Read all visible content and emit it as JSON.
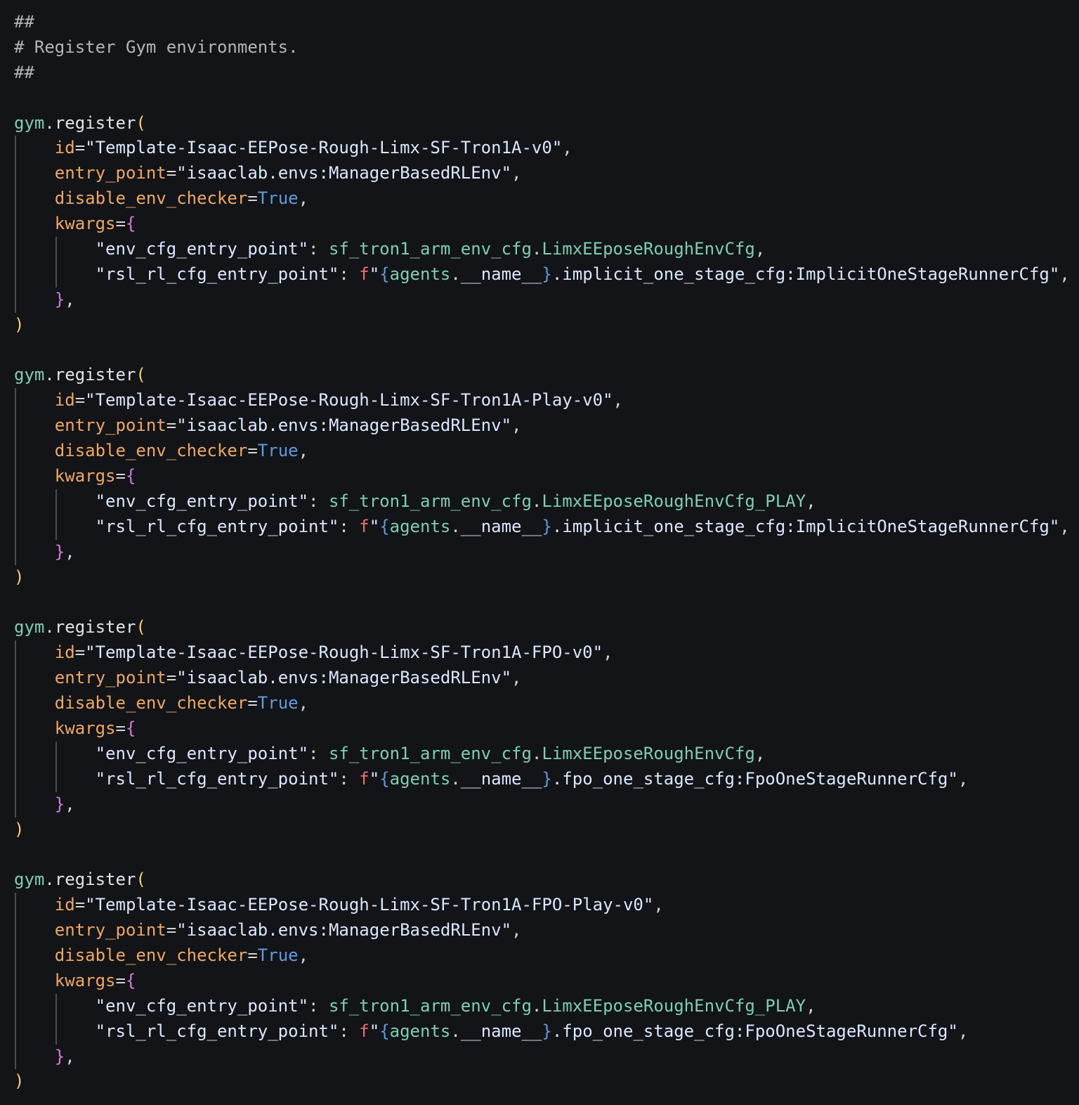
{
  "editor": {
    "theme": {
      "background": "#121418",
      "comment": "#b5b5b5",
      "module": "#7dcfb0",
      "function": "#e2e4e8",
      "paren": "#f4d35e",
      "keyword_arg": "#f0a860",
      "string": "#dbe7fb",
      "boolean": "#5e9be0",
      "brace": "#d57bd6",
      "fstring_prefix": "#ec6f6f"
    },
    "lines": [
      {
        "guides": [],
        "tokens": [
          {
            "t": "##",
            "c": "comment"
          }
        ]
      },
      {
        "guides": [],
        "tokens": [
          {
            "t": "# Register Gym environments.",
            "c": "comment"
          }
        ]
      },
      {
        "guides": [],
        "tokens": [
          {
            "t": "##",
            "c": "comment"
          }
        ]
      },
      {
        "guides": [],
        "tokens": []
      },
      {
        "guides": [],
        "tokens": [
          {
            "t": "gym",
            "c": "module"
          },
          {
            "t": ".",
            "c": "punct"
          },
          {
            "t": "register",
            "c": "fn"
          },
          {
            "t": "(",
            "c": "paren"
          }
        ]
      },
      {
        "guides": [
          0
        ],
        "tokens": [
          {
            "t": "    ",
            "c": "punct"
          },
          {
            "t": "id",
            "c": "kw"
          },
          {
            "t": "=",
            "c": "punct"
          },
          {
            "t": "\"Template-Isaac-EEPose-Rough-Limx-SF-Tron1A-v0\"",
            "c": "str"
          },
          {
            "t": ",",
            "c": "punct"
          }
        ]
      },
      {
        "guides": [
          0
        ],
        "tokens": [
          {
            "t": "    ",
            "c": "punct"
          },
          {
            "t": "entry_point",
            "c": "kw"
          },
          {
            "t": "=",
            "c": "punct"
          },
          {
            "t": "\"isaaclab.envs:ManagerBasedRLEnv\"",
            "c": "str"
          },
          {
            "t": ",",
            "c": "punct"
          }
        ]
      },
      {
        "guides": [
          0
        ],
        "tokens": [
          {
            "t": "    ",
            "c": "punct"
          },
          {
            "t": "disable_env_checker",
            "c": "kw"
          },
          {
            "t": "=",
            "c": "punct"
          },
          {
            "t": "True",
            "c": "bool"
          },
          {
            "t": ",",
            "c": "punct"
          }
        ]
      },
      {
        "guides": [
          0
        ],
        "tokens": [
          {
            "t": "    ",
            "c": "punct"
          },
          {
            "t": "kwargs",
            "c": "kw"
          },
          {
            "t": "=",
            "c": "punct"
          },
          {
            "t": "{",
            "c": "brace"
          }
        ]
      },
      {
        "guides": [
          0,
          1
        ],
        "tokens": [
          {
            "t": "        ",
            "c": "punct"
          },
          {
            "t": "\"env_cfg_entry_point\"",
            "c": "str"
          },
          {
            "t": ": ",
            "c": "punct"
          },
          {
            "t": "sf_tron1_arm_env_cfg",
            "c": "module"
          },
          {
            "t": ".",
            "c": "punct"
          },
          {
            "t": "LimxEEposeRoughEnvCfg",
            "c": "module"
          },
          {
            "t": ",",
            "c": "punct"
          }
        ]
      },
      {
        "guides": [
          0,
          1
        ],
        "tokens": [
          {
            "t": "        ",
            "c": "punct"
          },
          {
            "t": "\"rsl_rl_cfg_entry_point\"",
            "c": "str"
          },
          {
            "t": ": ",
            "c": "punct"
          },
          {
            "t": "f",
            "c": "fprefix"
          },
          {
            "t": "\"",
            "c": "str"
          },
          {
            "t": "{",
            "c": "ibrace"
          },
          {
            "t": "agents",
            "c": "ivar"
          },
          {
            "t": ".",
            "c": "punct"
          },
          {
            "t": "__name__",
            "c": "str"
          },
          {
            "t": "}",
            "c": "ibrace"
          },
          {
            "t": ".implicit_one_stage_cfg:ImplicitOneStageRunnerCfg\"",
            "c": "str"
          },
          {
            "t": ",",
            "c": "punct"
          }
        ]
      },
      {
        "guides": [
          0
        ],
        "tokens": [
          {
            "t": "    ",
            "c": "punct"
          },
          {
            "t": "}",
            "c": "brace"
          },
          {
            "t": ",",
            "c": "punct"
          }
        ]
      },
      {
        "guides": [],
        "tokens": [
          {
            "t": ")",
            "c": "paren"
          }
        ]
      },
      {
        "guides": [],
        "tokens": []
      },
      {
        "guides": [],
        "tokens": [
          {
            "t": "gym",
            "c": "module"
          },
          {
            "t": ".",
            "c": "punct"
          },
          {
            "t": "register",
            "c": "fn"
          },
          {
            "t": "(",
            "c": "paren"
          }
        ]
      },
      {
        "guides": [
          0
        ],
        "tokens": [
          {
            "t": "    ",
            "c": "punct"
          },
          {
            "t": "id",
            "c": "kw"
          },
          {
            "t": "=",
            "c": "punct"
          },
          {
            "t": "\"Template-Isaac-EEPose-Rough-Limx-SF-Tron1A-Play-v0\"",
            "c": "str"
          },
          {
            "t": ",",
            "c": "punct"
          }
        ]
      },
      {
        "guides": [
          0
        ],
        "tokens": [
          {
            "t": "    ",
            "c": "punct"
          },
          {
            "t": "entry_point",
            "c": "kw"
          },
          {
            "t": "=",
            "c": "punct"
          },
          {
            "t": "\"isaaclab.envs:ManagerBasedRLEnv\"",
            "c": "str"
          },
          {
            "t": ",",
            "c": "punct"
          }
        ]
      },
      {
        "guides": [
          0
        ],
        "tokens": [
          {
            "t": "    ",
            "c": "punct"
          },
          {
            "t": "disable_env_checker",
            "c": "kw"
          },
          {
            "t": "=",
            "c": "punct"
          },
          {
            "t": "True",
            "c": "bool"
          },
          {
            "t": ",",
            "c": "punct"
          }
        ]
      },
      {
        "guides": [
          0
        ],
        "tokens": [
          {
            "t": "    ",
            "c": "punct"
          },
          {
            "t": "kwargs",
            "c": "kw"
          },
          {
            "t": "=",
            "c": "punct"
          },
          {
            "t": "{",
            "c": "brace"
          }
        ]
      },
      {
        "guides": [
          0,
          1
        ],
        "tokens": [
          {
            "t": "        ",
            "c": "punct"
          },
          {
            "t": "\"env_cfg_entry_point\"",
            "c": "str"
          },
          {
            "t": ": ",
            "c": "punct"
          },
          {
            "t": "sf_tron1_arm_env_cfg",
            "c": "module"
          },
          {
            "t": ".",
            "c": "punct"
          },
          {
            "t": "LimxEEposeRoughEnvCfg_PLAY",
            "c": "module"
          },
          {
            "t": ",",
            "c": "punct"
          }
        ]
      },
      {
        "guides": [
          0,
          1
        ],
        "tokens": [
          {
            "t": "        ",
            "c": "punct"
          },
          {
            "t": "\"rsl_rl_cfg_entry_point\"",
            "c": "str"
          },
          {
            "t": ": ",
            "c": "punct"
          },
          {
            "t": "f",
            "c": "fprefix"
          },
          {
            "t": "\"",
            "c": "str"
          },
          {
            "t": "{",
            "c": "ibrace"
          },
          {
            "t": "agents",
            "c": "ivar"
          },
          {
            "t": ".",
            "c": "punct"
          },
          {
            "t": "__name__",
            "c": "str"
          },
          {
            "t": "}",
            "c": "ibrace"
          },
          {
            "t": ".implicit_one_stage_cfg:ImplicitOneStageRunnerCfg\"",
            "c": "str"
          },
          {
            "t": ",",
            "c": "punct"
          }
        ]
      },
      {
        "guides": [
          0
        ],
        "tokens": [
          {
            "t": "    ",
            "c": "punct"
          },
          {
            "t": "}",
            "c": "brace"
          },
          {
            "t": ",",
            "c": "punct"
          }
        ]
      },
      {
        "guides": [],
        "tokens": [
          {
            "t": ")",
            "c": "paren"
          }
        ]
      },
      {
        "guides": [],
        "tokens": []
      },
      {
        "guides": [],
        "tokens": [
          {
            "t": "gym",
            "c": "module"
          },
          {
            "t": ".",
            "c": "punct"
          },
          {
            "t": "register",
            "c": "fn"
          },
          {
            "t": "(",
            "c": "paren"
          }
        ]
      },
      {
        "guides": [
          0
        ],
        "tokens": [
          {
            "t": "    ",
            "c": "punct"
          },
          {
            "t": "id",
            "c": "kw"
          },
          {
            "t": "=",
            "c": "punct"
          },
          {
            "t": "\"Template-Isaac-EEPose-Rough-Limx-SF-Tron1A-FPO-v0\"",
            "c": "str"
          },
          {
            "t": ",",
            "c": "punct"
          }
        ]
      },
      {
        "guides": [
          0
        ],
        "tokens": [
          {
            "t": "    ",
            "c": "punct"
          },
          {
            "t": "entry_point",
            "c": "kw"
          },
          {
            "t": "=",
            "c": "punct"
          },
          {
            "t": "\"isaaclab.envs:ManagerBasedRLEnv\"",
            "c": "str"
          },
          {
            "t": ",",
            "c": "punct"
          }
        ]
      },
      {
        "guides": [
          0
        ],
        "tokens": [
          {
            "t": "    ",
            "c": "punct"
          },
          {
            "t": "disable_env_checker",
            "c": "kw"
          },
          {
            "t": "=",
            "c": "punct"
          },
          {
            "t": "True",
            "c": "bool"
          },
          {
            "t": ",",
            "c": "punct"
          }
        ]
      },
      {
        "guides": [
          0
        ],
        "tokens": [
          {
            "t": "    ",
            "c": "punct"
          },
          {
            "t": "kwargs",
            "c": "kw"
          },
          {
            "t": "=",
            "c": "punct"
          },
          {
            "t": "{",
            "c": "brace"
          }
        ]
      },
      {
        "guides": [
          0,
          1
        ],
        "tokens": [
          {
            "t": "        ",
            "c": "punct"
          },
          {
            "t": "\"env_cfg_entry_point\"",
            "c": "str"
          },
          {
            "t": ": ",
            "c": "punct"
          },
          {
            "t": "sf_tron1_arm_env_cfg",
            "c": "module"
          },
          {
            "t": ".",
            "c": "punct"
          },
          {
            "t": "LimxEEposeRoughEnvCfg",
            "c": "module"
          },
          {
            "t": ",",
            "c": "punct"
          }
        ]
      },
      {
        "guides": [
          0,
          1
        ],
        "tokens": [
          {
            "t": "        ",
            "c": "punct"
          },
          {
            "t": "\"rsl_rl_cfg_entry_point\"",
            "c": "str"
          },
          {
            "t": ": ",
            "c": "punct"
          },
          {
            "t": "f",
            "c": "fprefix"
          },
          {
            "t": "\"",
            "c": "str"
          },
          {
            "t": "{",
            "c": "ibrace"
          },
          {
            "t": "agents",
            "c": "ivar"
          },
          {
            "t": ".",
            "c": "punct"
          },
          {
            "t": "__name__",
            "c": "str"
          },
          {
            "t": "}",
            "c": "ibrace"
          },
          {
            "t": ".fpo_one_stage_cfg:FpoOneStageRunnerCfg\"",
            "c": "str"
          },
          {
            "t": ",",
            "c": "punct"
          }
        ]
      },
      {
        "guides": [
          0
        ],
        "tokens": [
          {
            "t": "    ",
            "c": "punct"
          },
          {
            "t": "}",
            "c": "brace"
          },
          {
            "t": ",",
            "c": "punct"
          }
        ]
      },
      {
        "guides": [],
        "tokens": [
          {
            "t": ")",
            "c": "paren"
          }
        ]
      },
      {
        "guides": [],
        "tokens": []
      },
      {
        "guides": [],
        "tokens": [
          {
            "t": "gym",
            "c": "module"
          },
          {
            "t": ".",
            "c": "punct"
          },
          {
            "t": "register",
            "c": "fn"
          },
          {
            "t": "(",
            "c": "paren"
          }
        ]
      },
      {
        "guides": [
          0
        ],
        "tokens": [
          {
            "t": "    ",
            "c": "punct"
          },
          {
            "t": "id",
            "c": "kw"
          },
          {
            "t": "=",
            "c": "punct"
          },
          {
            "t": "\"Template-Isaac-EEPose-Rough-Limx-SF-Tron1A-FPO-Play-v0\"",
            "c": "str"
          },
          {
            "t": ",",
            "c": "punct"
          }
        ]
      },
      {
        "guides": [
          0
        ],
        "tokens": [
          {
            "t": "    ",
            "c": "punct"
          },
          {
            "t": "entry_point",
            "c": "kw"
          },
          {
            "t": "=",
            "c": "punct"
          },
          {
            "t": "\"isaaclab.envs:ManagerBasedRLEnv\"",
            "c": "str"
          },
          {
            "t": ",",
            "c": "punct"
          }
        ]
      },
      {
        "guides": [
          0
        ],
        "tokens": [
          {
            "t": "    ",
            "c": "punct"
          },
          {
            "t": "disable_env_checker",
            "c": "kw"
          },
          {
            "t": "=",
            "c": "punct"
          },
          {
            "t": "True",
            "c": "bool"
          },
          {
            "t": ",",
            "c": "punct"
          }
        ]
      },
      {
        "guides": [
          0
        ],
        "tokens": [
          {
            "t": "    ",
            "c": "punct"
          },
          {
            "t": "kwargs",
            "c": "kw"
          },
          {
            "t": "=",
            "c": "punct"
          },
          {
            "t": "{",
            "c": "brace"
          }
        ]
      },
      {
        "guides": [
          0,
          1
        ],
        "tokens": [
          {
            "t": "        ",
            "c": "punct"
          },
          {
            "t": "\"env_cfg_entry_point\"",
            "c": "str"
          },
          {
            "t": ": ",
            "c": "punct"
          },
          {
            "t": "sf_tron1_arm_env_cfg",
            "c": "module"
          },
          {
            "t": ".",
            "c": "punct"
          },
          {
            "t": "LimxEEposeRoughEnvCfg_PLAY",
            "c": "module"
          },
          {
            "t": ",",
            "c": "punct"
          }
        ]
      },
      {
        "guides": [
          0,
          1
        ],
        "tokens": [
          {
            "t": "        ",
            "c": "punct"
          },
          {
            "t": "\"rsl_rl_cfg_entry_point\"",
            "c": "str"
          },
          {
            "t": ": ",
            "c": "punct"
          },
          {
            "t": "f",
            "c": "fprefix"
          },
          {
            "t": "\"",
            "c": "str"
          },
          {
            "t": "{",
            "c": "ibrace"
          },
          {
            "t": "agents",
            "c": "ivar"
          },
          {
            "t": ".",
            "c": "punct"
          },
          {
            "t": "__name__",
            "c": "str"
          },
          {
            "t": "}",
            "c": "ibrace"
          },
          {
            "t": ".fpo_one_stage_cfg:FpoOneStageRunnerCfg\"",
            "c": "str"
          },
          {
            "t": ",",
            "c": "punct"
          }
        ]
      },
      {
        "guides": [
          0
        ],
        "tokens": [
          {
            "t": "    ",
            "c": "punct"
          },
          {
            "t": "}",
            "c": "brace"
          },
          {
            "t": ",",
            "c": "punct"
          }
        ]
      },
      {
        "guides": [],
        "tokens": [
          {
            "t": ")",
            "c": "paren"
          }
        ]
      }
    ]
  }
}
